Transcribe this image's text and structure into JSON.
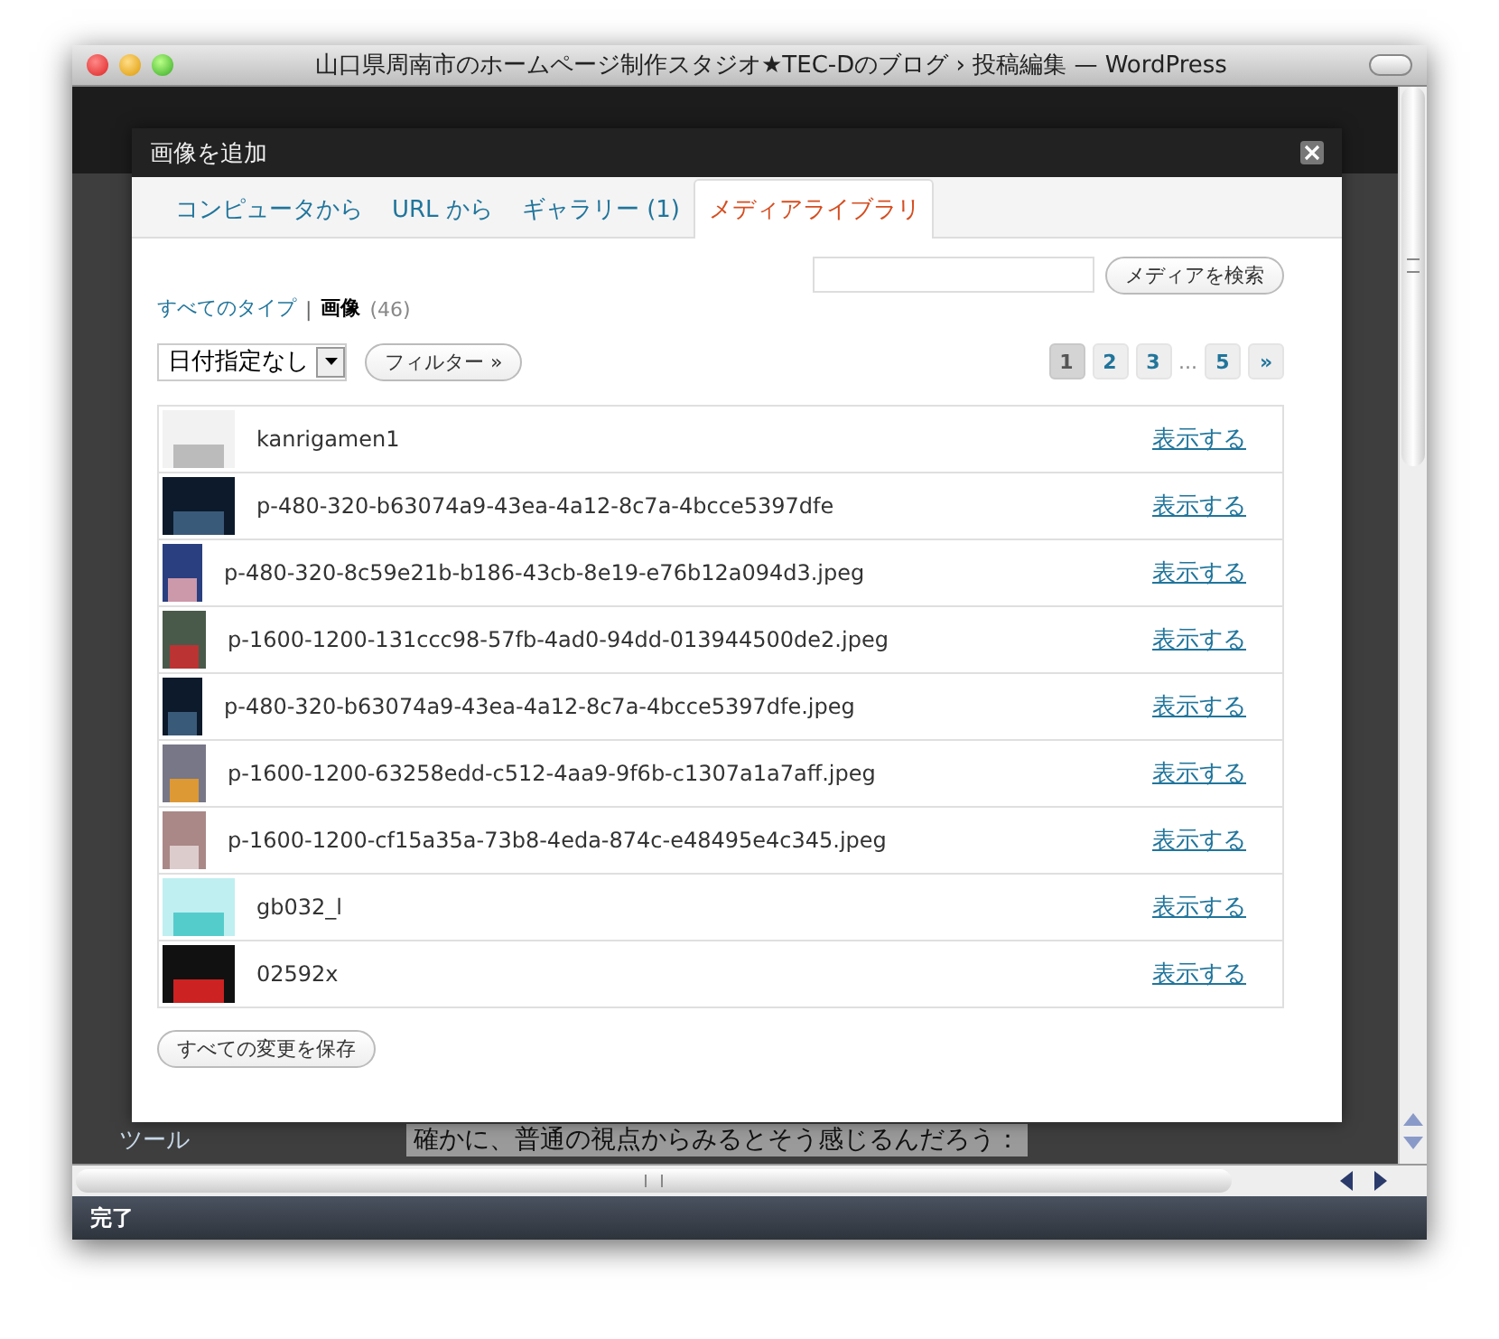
{
  "window": {
    "title": "山口県周南市のホームページ制作スタジオ★TEC-Dのブログ › 投稿編集 — WordPress"
  },
  "background": {
    "sidebar_label": "ツール",
    "editor_text": "確かに、普通の視点からみるとそう感じるんだろう："
  },
  "dialog": {
    "title": "画像を追加",
    "tabs": [
      {
        "label": "コンピュータから",
        "selected": false
      },
      {
        "label": "URL から",
        "selected": false
      },
      {
        "label": "ギャラリー (1)",
        "selected": false
      },
      {
        "label": "メディアライブラリ",
        "selected": true
      }
    ],
    "type_filters": [
      {
        "label": "すべてのタイプ",
        "selected": false
      },
      {
        "label": "画像",
        "count": "(46)",
        "selected": true
      }
    ],
    "type_separator": "|",
    "search": {
      "button": "メディアを検索"
    },
    "date_select": {
      "value": "日付指定なし"
    },
    "filter_button": "フィルター »",
    "pages": [
      {
        "label": "1",
        "kind": "page",
        "selected": true
      },
      {
        "label": "2",
        "kind": "page",
        "selected": false
      },
      {
        "label": "3",
        "kind": "page",
        "selected": false
      },
      {
        "label": "...",
        "kind": "gap"
      },
      {
        "label": "5",
        "kind": "page",
        "selected": false
      },
      {
        "label": "»",
        "kind": "page",
        "selected": false
      }
    ],
    "items": [
      {
        "filename": "kanrigamen1",
        "action": "表示する"
      },
      {
        "filename": "p-480-320-b63074a9-43ea-4a12-8c7a-4bcce5397dfe",
        "action": "表示する"
      },
      {
        "filename": "p-480-320-8c59e21b-b186-43cb-8e19-e76b12a094d3.jpeg",
        "action": "表示する"
      },
      {
        "filename": "p-1600-1200-131ccc98-57fb-4ad0-94dd-013944500de2.jpeg",
        "action": "表示する"
      },
      {
        "filename": "p-480-320-b63074a9-43ea-4a12-8c7a-4bcce5397dfe.jpeg",
        "action": "表示する"
      },
      {
        "filename": "p-1600-1200-63258edd-c512-4aa9-9f6b-c1307a1a7aff.jpeg",
        "action": "表示する"
      },
      {
        "filename": "p-1600-1200-cf15a35a-73b8-4eda-874c-e48495e4c345.jpeg",
        "action": "表示する"
      },
      {
        "filename": "gb032_l",
        "action": "表示する"
      },
      {
        "filename": "02592x",
        "action": "表示する"
      }
    ],
    "save_button": "すべての変更を保存"
  },
  "status_bar": {
    "text": "完了"
  }
}
